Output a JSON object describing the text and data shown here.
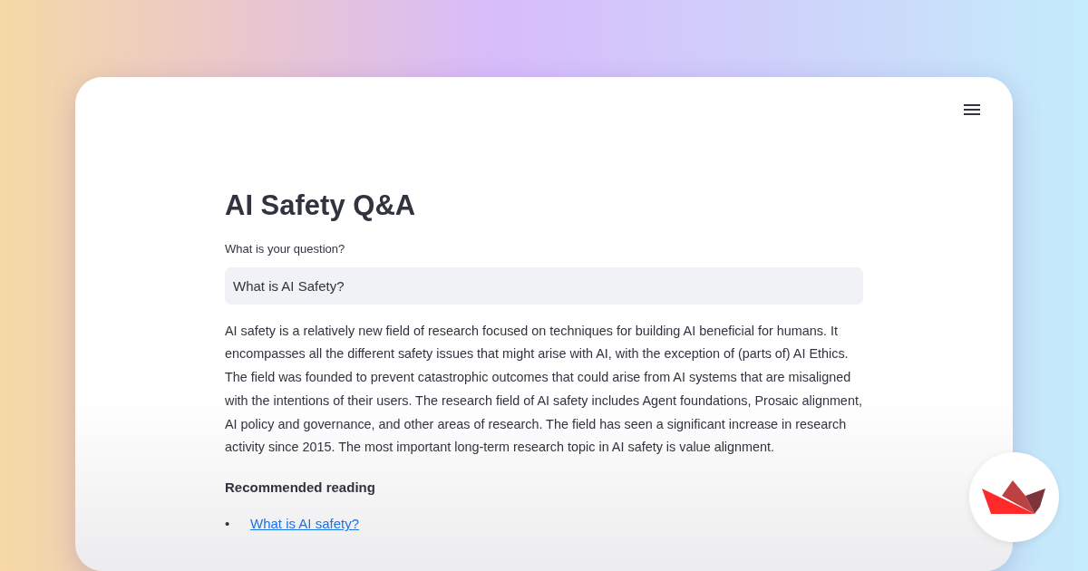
{
  "app": {
    "title": "AI Safety Q&A"
  },
  "question": {
    "label": "What is your question?",
    "value": "What is AI Safety?"
  },
  "answer": "AI safety is a relatively new field of research focused on techniques for building AI beneficial for humans. It encompasses all the different safety issues that might arise with AI, with the exception of (parts of) AI Ethics. The field was founded to prevent catastrophic outcomes that could arise from AI systems that are misaligned with the intentions of their users. The research field of AI safety includes Agent foundations, Prosaic alignment, AI policy and governance, and other areas of research. The field has seen a significant increase in research activity since 2015. The most important long-term research topic in AI safety is value alignment.",
  "reading": {
    "heading": "Recommended reading",
    "links": [
      {
        "bullet": "•",
        "text": "What is AI safety?"
      }
    ]
  }
}
